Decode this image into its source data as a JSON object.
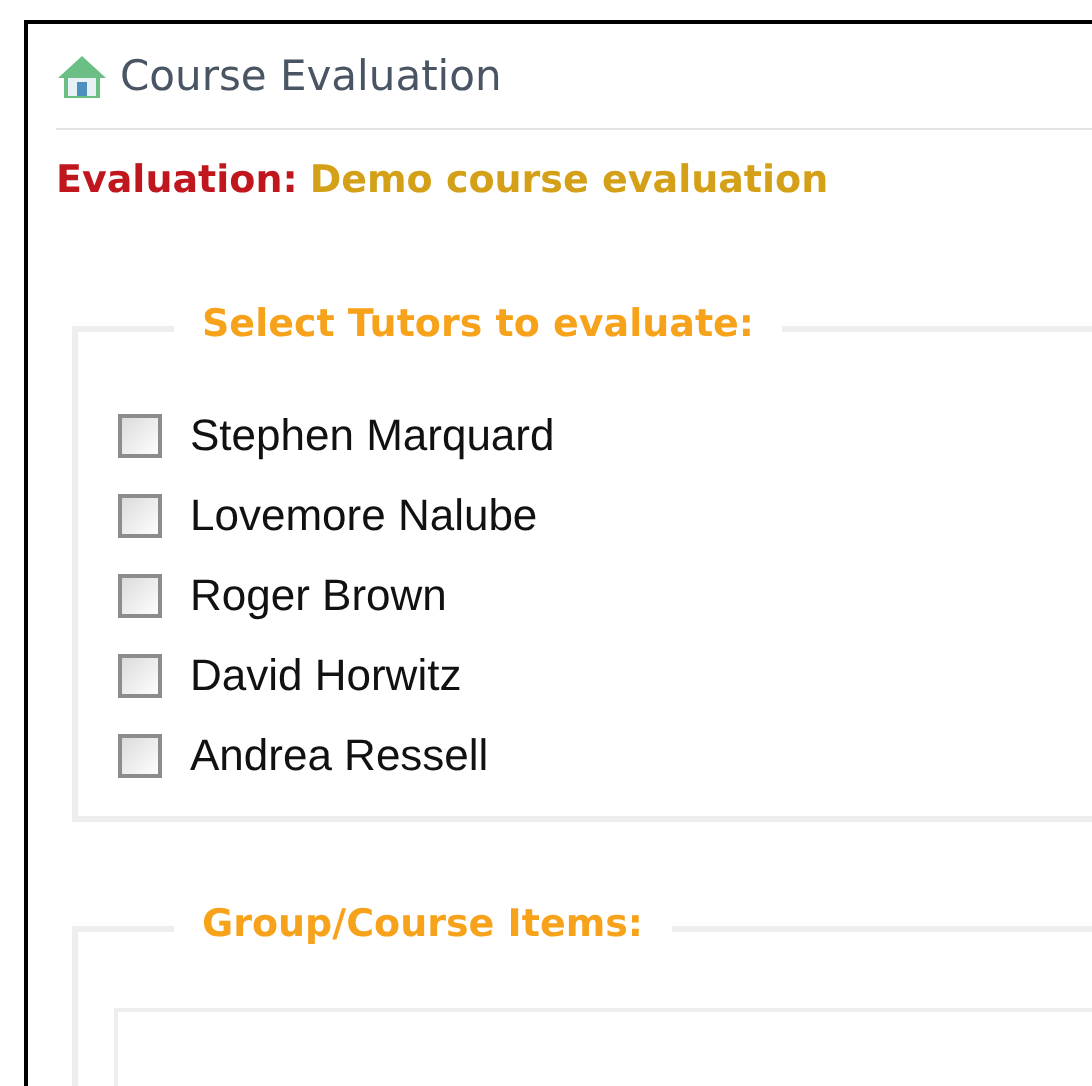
{
  "header": {
    "title": "Course Evaluation"
  },
  "evaluation": {
    "label": "Evaluation:",
    "name": "Demo course evaluation"
  },
  "tutors": {
    "legend": "Select Tutors to evaluate:",
    "items": [
      {
        "name": "Stephen Marquard",
        "checked": false
      },
      {
        "name": "Lovemore Nalube",
        "checked": false
      },
      {
        "name": "Roger Brown",
        "checked": false
      },
      {
        "name": "David Horwitz",
        "checked": false
      },
      {
        "name": "Andrea Ressell",
        "checked": false
      }
    ]
  },
  "group_items": {
    "legend": "Group/Course Items:"
  }
}
